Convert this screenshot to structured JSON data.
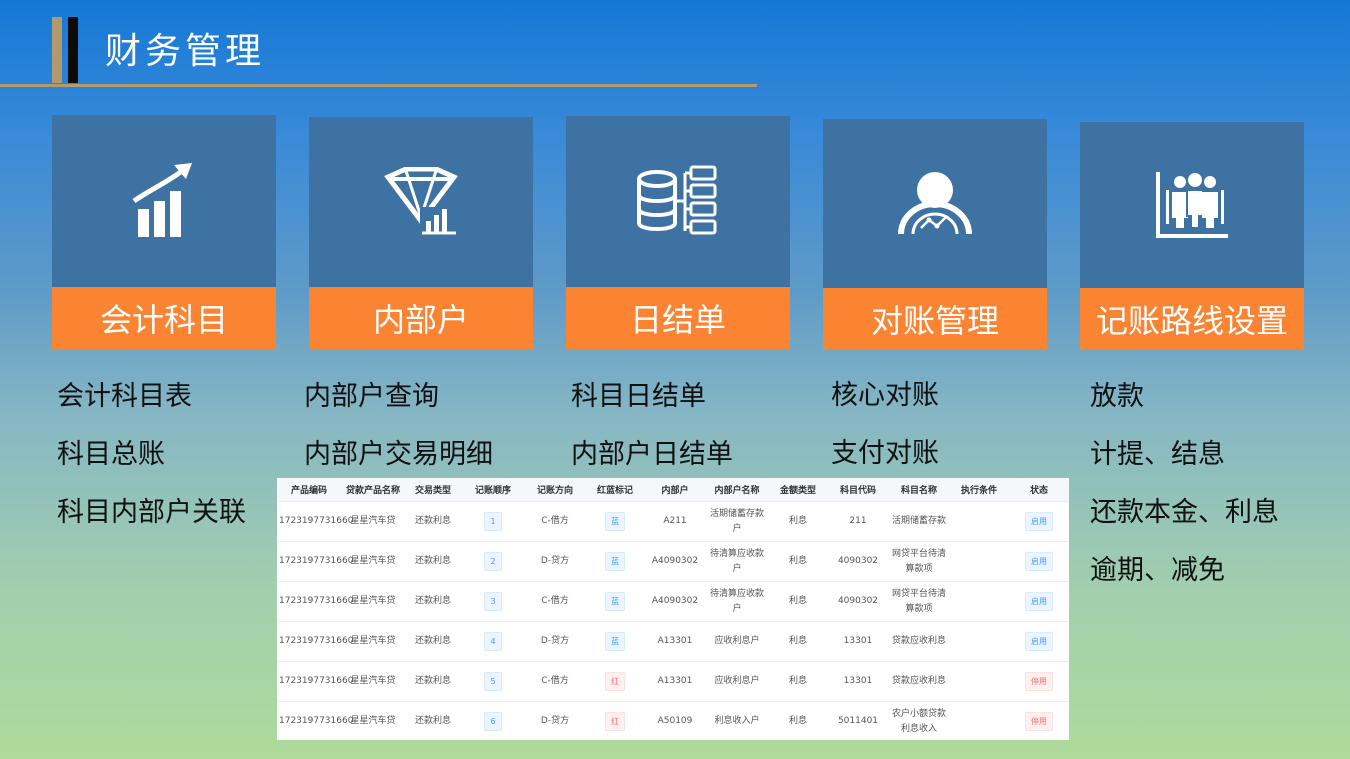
{
  "page_title": "财务管理",
  "cards": [
    {
      "label": "会计科目",
      "icon": "growth-chart-icon",
      "items": [
        "会计科目表",
        "科目总账",
        "科目内部户关联"
      ]
    },
    {
      "label": "内部户",
      "icon": "diamond-chart-icon",
      "items": [
        "内部户查询",
        "内部户交易明细"
      ]
    },
    {
      "label": "日结单",
      "icon": "database-list-icon",
      "items": [
        "科目日结单",
        "内部户日结单"
      ]
    },
    {
      "label": "对账管理",
      "icon": "person-gauge-icon",
      "items": [
        "核心对账",
        "支付对账"
      ]
    },
    {
      "label": "记账路线设置",
      "icon": "team-chart-icon",
      "items": [
        "放款",
        "计提、结息",
        "还款本金、利息",
        "逾期、减免"
      ]
    }
  ],
  "table": {
    "headers": [
      "产品编码",
      "贷款产品名称",
      "交易类型",
      "记账顺序",
      "记账方向",
      "红蓝标记",
      "内部户",
      "内部户名称",
      "金额类型",
      "科目代码",
      "科目名称",
      "执行条件",
      "状态"
    ],
    "rows": [
      {
        "code": "1723197731660",
        "product": "星星汽车贷",
        "trade": "还款利息",
        "order": "1",
        "direction": "C-借方",
        "mark": "蓝",
        "mark_color": "#409eff",
        "account": "A211",
        "account_name": "活期储蓄存款户",
        "amount_type": "利息",
        "subject_code": "211",
        "subject_name": "活期储蓄存款",
        "condition": "",
        "status": "启用",
        "status_color": "#409eff"
      },
      {
        "code": "1723197731660",
        "product": "星星汽车贷",
        "trade": "还款利息",
        "order": "2",
        "direction": "D-贷方",
        "mark": "蓝",
        "mark_color": "#409eff",
        "account": "A4090302",
        "account_name": "待清算应收款户",
        "amount_type": "利息",
        "subject_code": "4090302",
        "subject_name": "网贷平台待清算款项",
        "condition": "",
        "status": "启用",
        "status_color": "#409eff"
      },
      {
        "code": "1723197731660",
        "product": "星星汽车贷",
        "trade": "还款利息",
        "order": "3",
        "direction": "C-借方",
        "mark": "蓝",
        "mark_color": "#409eff",
        "account": "A4090302",
        "account_name": "待清算应收款户",
        "amount_type": "利息",
        "subject_code": "4090302",
        "subject_name": "网贷平台待清算款项",
        "condition": "",
        "status": "启用",
        "status_color": "#409eff"
      },
      {
        "code": "1723197731660",
        "product": "星星汽车贷",
        "trade": "还款利息",
        "order": "4",
        "direction": "D-贷方",
        "mark": "蓝",
        "mark_color": "#409eff",
        "account": "A13301",
        "account_name": "应收利息户",
        "amount_type": "利息",
        "subject_code": "13301",
        "subject_name": "贷款应收利息",
        "condition": "",
        "status": "启用",
        "status_color": "#409eff"
      },
      {
        "code": "1723197731660",
        "product": "星星汽车贷",
        "trade": "还款利息",
        "order": "5",
        "direction": "C-借方",
        "mark": "红",
        "mark_color": "#f56c6c",
        "account": "A13301",
        "account_name": "应收利息户",
        "amount_type": "利息",
        "subject_code": "13301",
        "subject_name": "贷款应收利息",
        "condition": "",
        "status": "停用",
        "status_color": "#f56c6c"
      },
      {
        "code": "1723197731660",
        "product": "星星汽车贷",
        "trade": "还款利息",
        "order": "6",
        "direction": "D-贷方",
        "mark": "红",
        "mark_color": "#f56c6c",
        "account": "A50109",
        "account_name": "利息收入户",
        "amount_type": "利息",
        "subject_code": "5011401",
        "subject_name": "农户小额贷款利息收入",
        "condition": "",
        "status": "停用",
        "status_color": "#f56c6c"
      }
    ]
  },
  "colors": {
    "card_icon_bg": "#3e72a3",
    "card_label_bg": "#fb8433",
    "accent_line": "#b29a6e"
  }
}
